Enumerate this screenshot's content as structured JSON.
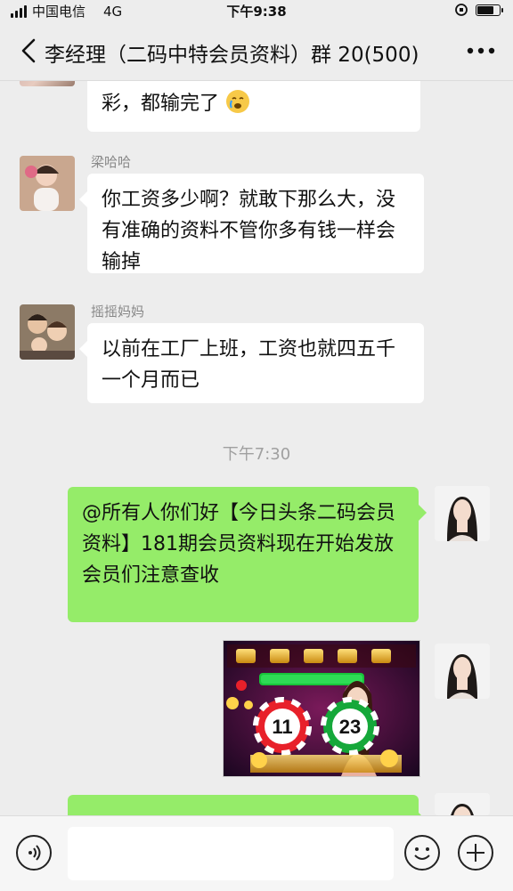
{
  "status_bar": {
    "carrier": "中国电信",
    "network": "4G",
    "time": "下午9:38",
    "battery_level": 0.8
  },
  "header": {
    "title": "李经理（二码中特会员资料）群 20(500)",
    "back_icon": "chevron-left-icon",
    "more_icon": "more-dots-icon"
  },
  "messages": [
    {
      "type": "text",
      "direction": "in",
      "text": "彩，都输完了"
    },
    {
      "type": "text",
      "direction": "in",
      "sender": "梁哈哈",
      "text": "你工资多少啊？就敢下那么大，没有准确的资料不管你多有钱一样会输掉"
    },
    {
      "type": "text",
      "direction": "in",
      "sender": "摇摇妈妈",
      "text": "以前在工厂上班，工资也就四五千一个月而已"
    },
    {
      "type": "timestamp",
      "text": "下午7:30"
    },
    {
      "type": "text",
      "direction": "out",
      "text": "@所有人你们好【今日头条二码会员资料】181期会员资料现在开始发放会员们注意查收"
    },
    {
      "type": "image",
      "direction": "out",
      "numbers": [
        "11",
        "23"
      ]
    }
  ],
  "input_bar": {
    "voice_icon": "voice-icon",
    "emoji_icon": "emoji-icon",
    "plus_icon": "plus-icon",
    "accent": "#95ec69"
  }
}
